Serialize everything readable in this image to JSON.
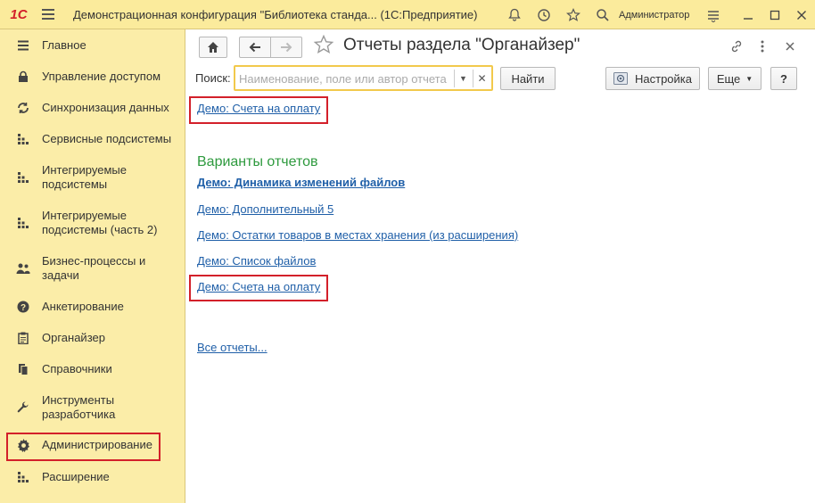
{
  "titlebar": {
    "logo": "1С",
    "title": "Демонстрационная конфигурация \"Библиотека станда...  (1С:Предприятие)",
    "user": "Администратор"
  },
  "sidebar": {
    "items": [
      {
        "label": "Главное",
        "icon": "list-icon"
      },
      {
        "label": "Управление доступом",
        "icon": "lock-icon"
      },
      {
        "label": "Синхронизация данных",
        "icon": "sync-icon"
      },
      {
        "label": "Сервисные подсистемы",
        "icon": "grid-icon"
      },
      {
        "label": "Интегрируемые подсистемы",
        "icon": "grid-icon"
      },
      {
        "label": "Интегрируемые подсистемы (часть 2)",
        "icon": "grid-icon"
      },
      {
        "label": "Бизнес-процессы и задачи",
        "icon": "people-icon"
      },
      {
        "label": "Анкетирование",
        "icon": "question-icon"
      },
      {
        "label": "Органайзер",
        "icon": "clipboard-icon"
      },
      {
        "label": "Справочники",
        "icon": "book-icon"
      },
      {
        "label": "Инструменты разработчика",
        "icon": "wrench-icon"
      },
      {
        "label": "Администрирование",
        "icon": "gear-icon"
      },
      {
        "label": "Расширение",
        "icon": "grid-icon"
      }
    ]
  },
  "main": {
    "title": "Отчеты раздела \"Органайзер\"",
    "search": {
      "label": "Поиск:",
      "value": "",
      "placeholder": "Наименование, поле или автор отчета"
    },
    "buttons": {
      "find": "Найти",
      "settings": "Настройка",
      "more": "Еще",
      "help": "?"
    },
    "top_link": "Демо: Счета на оплату",
    "section_title": "Варианты отчетов",
    "variants": [
      "Демо: Динамика изменений файлов",
      "Демо: Дополнительный 5",
      "Демо: Остатки товаров в местах хранения (из расширения)",
      "Демо: Список файлов",
      "Демо: Счета на оплату"
    ],
    "all_reports": "Все отчеты..."
  },
  "colors": {
    "sidebar_bg": "#fbeda8",
    "link": "#1f5fa8",
    "section_title": "#2e9a3e",
    "highlight": "#d3202a"
  }
}
